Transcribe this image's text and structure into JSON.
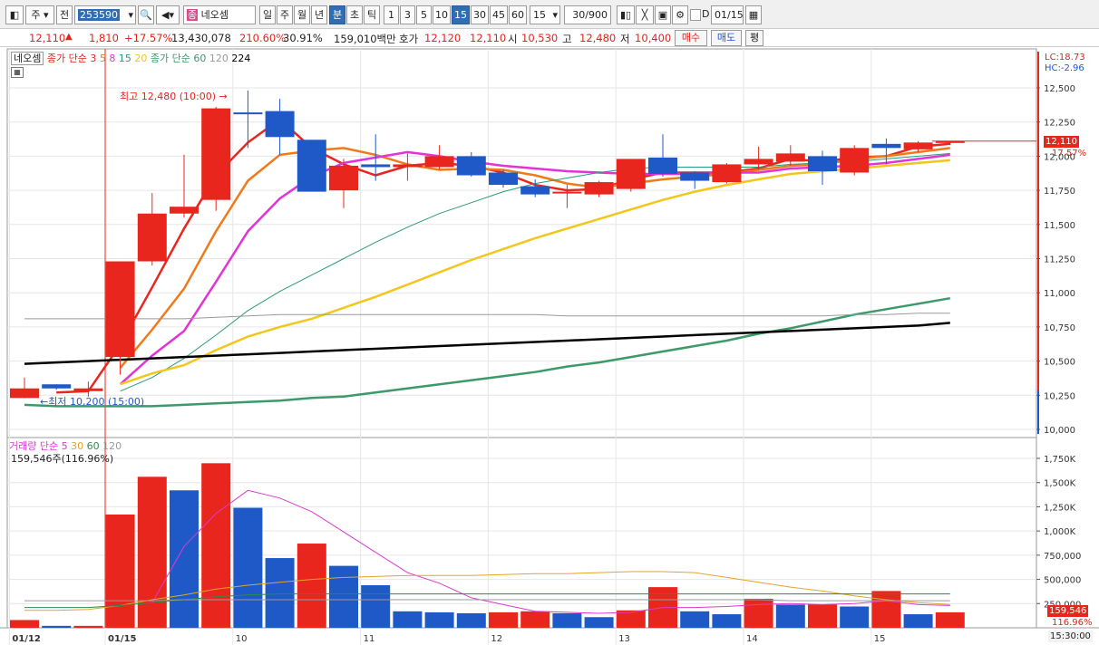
{
  "toolbar": {
    "market_type": "주",
    "prev_label": "전",
    "stock_code": "253590",
    "stock_name_badge": "종",
    "stock_name": "네오셈",
    "periods": [
      "일",
      "주",
      "월",
      "년"
    ],
    "unit_buttons": [
      "분",
      "초",
      "틱"
    ],
    "intervals": [
      "1",
      "3",
      "5",
      "10",
      "15",
      "30",
      "45",
      "60"
    ],
    "selected_interval": "15",
    "interval_select": "15",
    "count": "30",
    "count_max": "/900",
    "date_toggle": "D",
    "date": "01/15"
  },
  "quote": {
    "price": "12,110",
    "change_arrow": "▲",
    "change": "1,810",
    "change_pct": "+17.57%",
    "volume": "13,430,078",
    "volume_ratio": "210.60%",
    "turnover_rate": "30.91%",
    "amount": "159,010백만",
    "ask_label": "호가",
    "ask_price": "12,120",
    "bid_price": "12,110",
    "open_label": "시",
    "open": "10,530",
    "high_label": "고",
    "high": "12,480",
    "low_label": "저",
    "low": "10,400",
    "buy_label": "매수",
    "sell_label": "매도",
    "avg_label": "평"
  },
  "price_legend": {
    "name": "네오셈",
    "ma_title": "종가 단순",
    "ma_periods": [
      "3",
      "5",
      "8",
      "15",
      "20"
    ],
    "ma2_title": "종가 단순",
    "ma2_periods": [
      "60",
      "120",
      "224"
    ]
  },
  "volume_legend": {
    "title": "거래량",
    "ma_title": "단순",
    "ma_periods": [
      "5",
      "30",
      "60",
      "120"
    ],
    "value": "159,546주(116.96%)"
  },
  "annotations": {
    "high_text": "최고 12,480 (10:00)",
    "low_text": "최저 10,200 (15:00)"
  },
  "right_tags": {
    "lc": "LC:18.73",
    "hc": "HC:-2.96",
    "current": "12,110",
    "current_pct": "17.57%",
    "vol_value": "159,546",
    "vol_pct": "116.96%",
    "time": "15:30:00"
  },
  "colors": {
    "up": "#e8261d",
    "down": "#1f59c8",
    "ma3": "#e8261d",
    "ma5": "#f07a1a",
    "ma8": "#e233d6",
    "ma15": "#2c9a7a",
    "ma20": "#f2c61b",
    "ma60": "#3c9a6a",
    "ma120": "#9a9a9a",
    "ma224": "#000000"
  },
  "chart_data": [
    {
      "type": "candlestick",
      "title": "네오셈",
      "ylim": [
        10000,
        12600
      ],
      "yticks": [
        "12,500",
        "12,250",
        "12,000",
        "11,750",
        "11,500",
        "11,250",
        "11,000",
        "10,750",
        "10,500",
        "10,250",
        "10,000"
      ],
      "ytick_values": [
        12500,
        12250,
        12000,
        11750,
        11500,
        11250,
        11000,
        10750,
        10500,
        10250,
        10000
      ],
      "xticks": [
        {
          "label": "01/12",
          "index": 0
        },
        {
          "label": "01/15",
          "index": 3
        },
        {
          "label": "10",
          "index": 7
        },
        {
          "label": "11",
          "index": 11
        },
        {
          "label": "12",
          "index": 15
        },
        {
          "label": "13",
          "index": 19
        },
        {
          "label": "14",
          "index": 23
        },
        {
          "label": "15",
          "index": 27
        }
      ],
      "candles": [
        {
          "o": 10300,
          "h": 10380,
          "l": 10230,
          "c": 10230,
          "up": true
        },
        {
          "o": 10330,
          "h": 10330,
          "l": 10290,
          "c": 10300,
          "up": false
        },
        {
          "o": 10280,
          "h": 10350,
          "l": 10240,
          "c": 10300,
          "up": true
        },
        {
          "o": 10530,
          "h": 10900,
          "l": 10400,
          "c": 11230,
          "up": true
        },
        {
          "o": 11230,
          "h": 11730,
          "l": 11200,
          "c": 11580,
          "up": true
        },
        {
          "o": 11580,
          "h": 12010,
          "l": 11550,
          "c": 11630,
          "up": true
        },
        {
          "o": 11680,
          "h": 12360,
          "l": 11600,
          "c": 12350,
          "up": true
        },
        {
          "o": 12320,
          "h": 12480,
          "l": 12060,
          "c": 12310,
          "up": false
        },
        {
          "o": 12330,
          "h": 12420,
          "l": 12010,
          "c": 12140,
          "up": false
        },
        {
          "o": 12120,
          "h": 12120,
          "l": 11750,
          "c": 11740,
          "up": false
        },
        {
          "o": 11750,
          "h": 11980,
          "l": 11620,
          "c": 11930,
          "up": true
        },
        {
          "o": 11940,
          "h": 12160,
          "l": 11820,
          "c": 11920,
          "up": false
        },
        {
          "o": 11920,
          "h": 12020,
          "l": 11820,
          "c": 11940,
          "up": true
        },
        {
          "o": 11920,
          "h": 12080,
          "l": 11900,
          "c": 12000,
          "up": true
        },
        {
          "o": 12000,
          "h": 12030,
          "l": 11850,
          "c": 11860,
          "up": false
        },
        {
          "o": 11880,
          "h": 11900,
          "l": 11770,
          "c": 11790,
          "up": false
        },
        {
          "o": 11780,
          "h": 11830,
          "l": 11700,
          "c": 11720,
          "up": false
        },
        {
          "o": 11740,
          "h": 11790,
          "l": 11620,
          "c": 11740,
          "up": true
        },
        {
          "o": 11720,
          "h": 11820,
          "l": 11700,
          "c": 11810,
          "up": true
        },
        {
          "o": 11760,
          "h": 11980,
          "l": 11740,
          "c": 11980,
          "up": true
        },
        {
          "o": 11990,
          "h": 12160,
          "l": 11850,
          "c": 11870,
          "up": false
        },
        {
          "o": 11880,
          "h": 11890,
          "l": 11760,
          "c": 11820,
          "up": false
        },
        {
          "o": 11810,
          "h": 11950,
          "l": 11800,
          "c": 11940,
          "up": true
        },
        {
          "o": 11940,
          "h": 12070,
          "l": 11900,
          "c": 11980,
          "up": true
        },
        {
          "o": 11960,
          "h": 12080,
          "l": 11930,
          "c": 12020,
          "up": true
        },
        {
          "o": 12000,
          "h": 12040,
          "l": 11790,
          "c": 11890,
          "up": false
        },
        {
          "o": 11880,
          "h": 12080,
          "l": 11860,
          "c": 12060,
          "up": true
        },
        {
          "o": 12090,
          "h": 12130,
          "l": 11940,
          "c": 12060,
          "up": false
        },
        {
          "o": 12050,
          "h": 12110,
          "l": 12030,
          "c": 12100,
          "up": true
        },
        {
          "o": 12100,
          "h": 12110,
          "l": 12080,
          "c": 12110,
          "up": true
        }
      ],
      "series": [
        {
          "name": "3",
          "color": "#e8261d",
          "values": [
            null,
            10270,
            10280,
            10620,
            11040,
            11470,
            11860,
            12100,
            12270,
            12060,
            11940,
            11860,
            11930,
            11950,
            11930,
            11880,
            11790,
            11750,
            11760,
            11830,
            11880,
            11880,
            11880,
            11910,
            11980,
            11960,
            11990,
            12000,
            12070,
            12090
          ]
        },
        {
          "name": "5",
          "color": "#f07a1a",
          "values": [
            null,
            null,
            null,
            10450,
            10730,
            11030,
            11450,
            11820,
            12010,
            12040,
            12060,
            12010,
            11940,
            11900,
            11910,
            11900,
            11860,
            11800,
            11770,
            11800,
            11830,
            11850,
            11870,
            11900,
            11930,
            11940,
            11980,
            12000,
            12030,
            12060
          ]
        },
        {
          "name": "8",
          "color": "#e233d6",
          "values": [
            null,
            null,
            null,
            10330,
            10540,
            10720,
            11080,
            11450,
            11690,
            11850,
            11950,
            11990,
            12030,
            12000,
            11960,
            11930,
            11910,
            11890,
            11880,
            11870,
            11870,
            11870,
            11880,
            11880,
            11910,
            11920,
            11930,
            11950,
            11980,
            12010
          ]
        },
        {
          "name": "15",
          "color": "#2c9a7a",
          "values": [
            null,
            null,
            null,
            10280,
            10380,
            10520,
            10690,
            10870,
            11010,
            11130,
            11250,
            11370,
            11480,
            11580,
            11660,
            11740,
            11800,
            11840,
            11880,
            11910,
            11920,
            11920,
            11920,
            11920,
            11940,
            11950,
            11960,
            11980,
            12000,
            12020
          ]
        },
        {
          "name": "20",
          "color": "#f2c61b",
          "values": [
            null,
            null,
            null,
            10330,
            10410,
            10470,
            10580,
            10680,
            10750,
            10810,
            10890,
            10970,
            11060,
            11150,
            11240,
            11320,
            11400,
            11470,
            11540,
            11610,
            11680,
            11740,
            11790,
            11830,
            11870,
            11890,
            11910,
            11930,
            11950,
            11970
          ]
        },
        {
          "name": "60",
          "color": "#3c9a6a",
          "values": [
            10180,
            10170,
            10170,
            10170,
            10170,
            10180,
            10190,
            10200,
            10210,
            10230,
            10240,
            10270,
            10300,
            10330,
            10360,
            10390,
            10420,
            10460,
            10490,
            10530,
            10570,
            10610,
            10650,
            10700,
            10740,
            10790,
            10840,
            10880,
            10920,
            10960
          ]
        },
        {
          "name": "120",
          "color": "#9a9a9a",
          "values": [
            10810,
            10810,
            10810,
            10810,
            10810,
            10810,
            10820,
            10830,
            10840,
            10840,
            10840,
            10840,
            10840,
            10840,
            10840,
            10840,
            10840,
            10830,
            10830,
            10830,
            10830,
            10830,
            10830,
            10830,
            10830,
            10830,
            10840,
            10840,
            10850,
            10850
          ]
        },
        {
          "name": "224",
          "color": "#000000",
          "values": [
            10480,
            10490,
            10500,
            10510,
            10520,
            10530,
            10540,
            10550,
            10560,
            10570,
            10580,
            10590,
            10600,
            10610,
            10620,
            10630,
            10640,
            10650,
            10660,
            10670,
            10680,
            10690,
            10700,
            10710,
            10720,
            10730,
            10740,
            10750,
            10760,
            10780
          ]
        }
      ]
    },
    {
      "type": "bar",
      "title": "거래량",
      "ylim": [
        0,
        1900000
      ],
      "yticks": [
        "1,750K",
        "1,500K",
        "1,250K",
        "1,000K",
        "750,000",
        "500,000",
        "250,000"
      ],
      "ytick_values": [
        1750000,
        1500000,
        1250000,
        1000000,
        750000,
        500000,
        250000
      ],
      "values": [
        80000,
        20000,
        20000,
        1170000,
        1560000,
        1420000,
        1700000,
        1240000,
        720000,
        870000,
        640000,
        440000,
        170000,
        160000,
        150000,
        160000,
        170000,
        150000,
        110000,
        180000,
        420000,
        170000,
        140000,
        300000,
        240000,
        240000,
        220000,
        380000,
        140000,
        160000
      ],
      "colors_up": [
        true,
        false,
        true,
        true,
        true,
        false,
        true,
        false,
        false,
        true,
        false,
        false,
        false,
        false,
        false,
        true,
        true,
        false,
        false,
        true,
        true,
        false,
        false,
        true,
        false,
        true,
        false,
        true,
        false,
        true
      ],
      "series": [
        {
          "name": "5",
          "color": "#d93bd0",
          "values": [
            null,
            null,
            null,
            null,
            260000,
            840000,
            1180000,
            1420000,
            1340000,
            1200000,
            990000,
            780000,
            570000,
            460000,
            310000,
            240000,
            170000,
            160000,
            150000,
            160000,
            210000,
            210000,
            220000,
            240000,
            250000,
            240000,
            250000,
            280000,
            240000,
            230000
          ]
        },
        {
          "name": "30",
          "color": "#e0a62a",
          "values": [
            180000,
            180000,
            190000,
            230000,
            290000,
            340000,
            400000,
            440000,
            470000,
            500000,
            520000,
            530000,
            540000,
            540000,
            540000,
            550000,
            560000,
            560000,
            570000,
            580000,
            580000,
            570000,
            520000,
            470000,
            420000,
            380000,
            330000,
            290000,
            260000,
            240000
          ]
        },
        {
          "name": "60",
          "color": "#2c8a4a",
          "values": [
            210000,
            210000,
            210000,
            230000,
            260000,
            290000,
            320000,
            340000,
            350000,
            350000,
            350000,
            350000,
            350000,
            350000,
            350000,
            350000,
            350000,
            350000,
            350000,
            350000,
            350000,
            350000,
            350000,
            350000,
            350000,
            350000,
            350000,
            350000,
            350000,
            350000
          ]
        },
        {
          "name": "120",
          "color": "#9a9a9a",
          "values": [
            280000,
            280000,
            280000,
            280000,
            280000,
            290000,
            290000,
            290000,
            290000,
            290000,
            290000,
            290000,
            290000,
            290000,
            290000,
            290000,
            290000,
            290000,
            290000,
            290000,
            290000,
            290000,
            290000,
            290000,
            280000,
            280000,
            280000,
            280000,
            280000,
            280000
          ]
        }
      ]
    }
  ]
}
